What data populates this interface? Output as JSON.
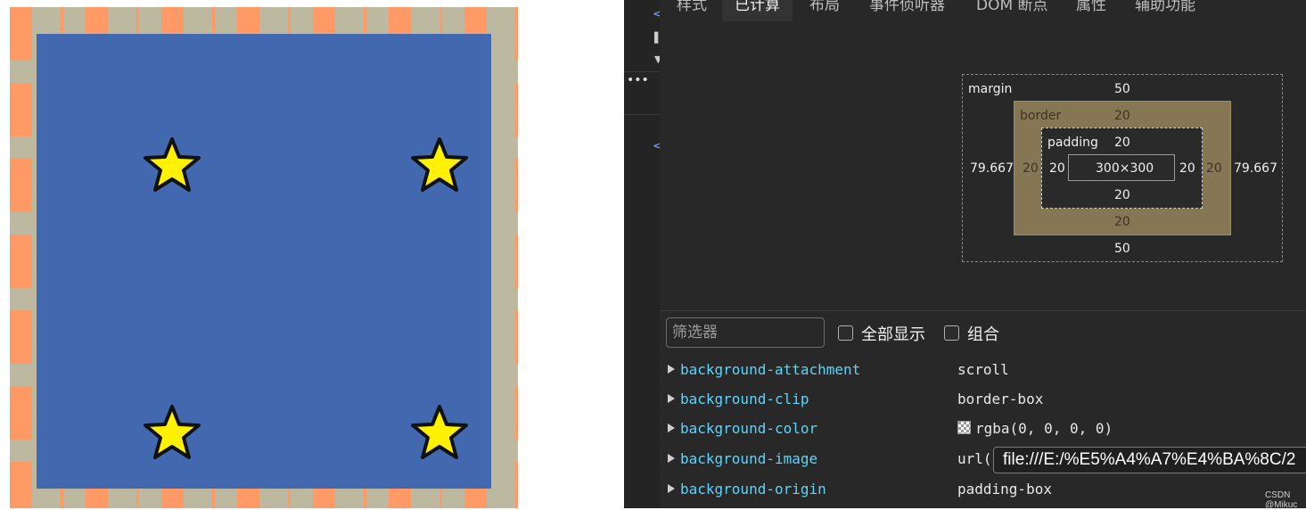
{
  "preview": {
    "colors": {
      "border_orange": "#FF9966",
      "border_stripe": "#BDB9A0",
      "content_blue": "#4268AF",
      "star_yellow": "#FFF200"
    },
    "stars": [
      "star-icon",
      "star-icon",
      "star-icon",
      "star-icon"
    ]
  },
  "devtools": {
    "tabs": [
      "样式",
      "已计算",
      "布局",
      "事件侦听器",
      "DOM 断点",
      "属性",
      "辅助功能"
    ],
    "active_tab": "已计算",
    "box_model": {
      "margin_label": "margin",
      "margin_top": "50",
      "margin_bottom": "50",
      "margin_left": "79.667",
      "margin_right": "79.667",
      "border_label": "border",
      "border_top": "20",
      "border_bottom": "20",
      "border_left": "20",
      "border_right": "20",
      "padding_label": "padding",
      "padding_top": "20",
      "padding_bottom": "20",
      "padding_left": "20",
      "padding_right": "20",
      "content_size": "300×300"
    },
    "filter": {
      "placeholder": "筛选器",
      "show_all_label": "全部显示",
      "group_label": "组合"
    },
    "properties": [
      {
        "name": "background-attachment",
        "value": "scroll"
      },
      {
        "name": "background-clip",
        "value": "border-box"
      },
      {
        "name": "background-color",
        "value": "rgba(0, 0, 0, 0)"
      },
      {
        "name": "background-image",
        "value": "url("
      },
      {
        "name": "background-origin",
        "value": "padding-box"
      }
    ],
    "tooltip": "file:///E:/%E5%A4%A7%E4%BA%8C/2",
    "watermark": "CSDN @Mikuc"
  }
}
